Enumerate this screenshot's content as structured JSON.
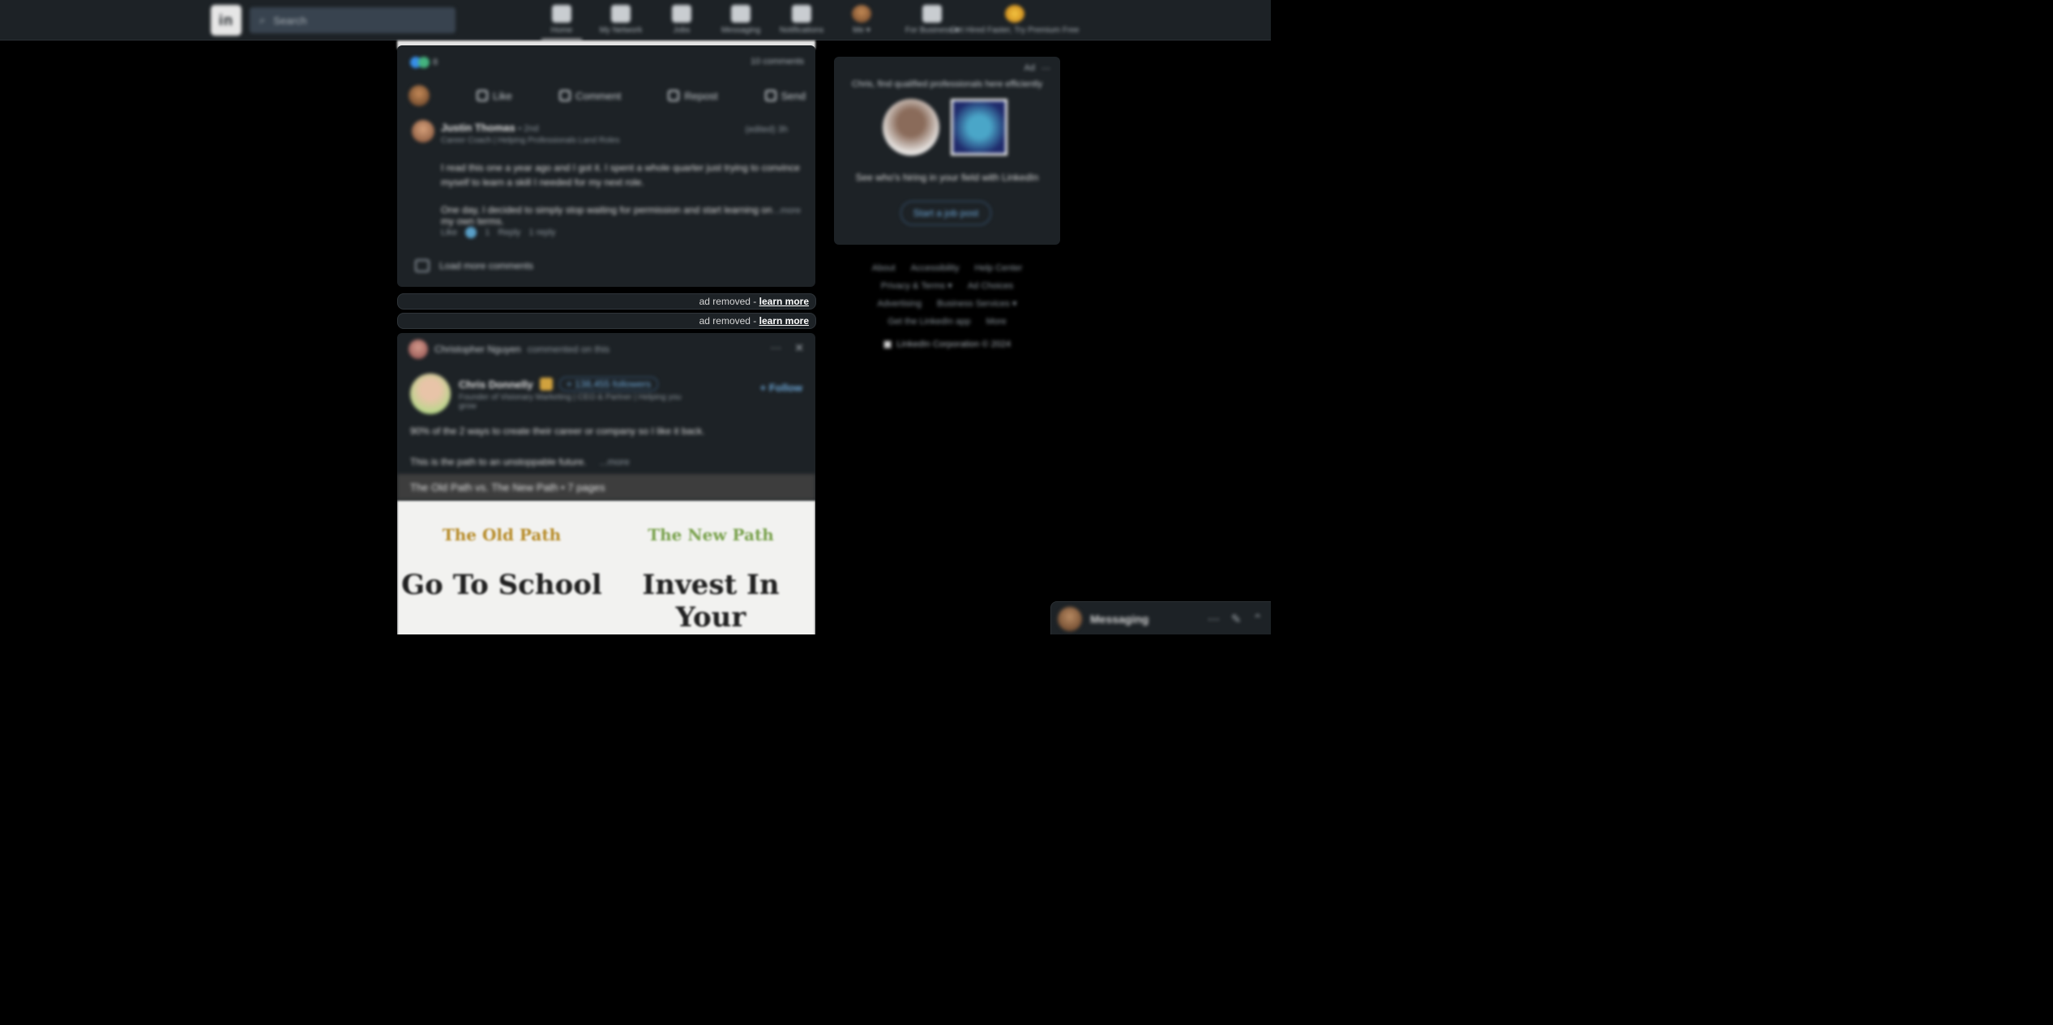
{
  "nav": {
    "logo_text": "in",
    "search_placeholder": "Search",
    "items": [
      {
        "label": "Home",
        "icon": "home-icon"
      },
      {
        "label": "My Network",
        "icon": "network-icon"
      },
      {
        "label": "Jobs",
        "icon": "jobs-icon"
      },
      {
        "label": "Messaging",
        "icon": "messaging-icon"
      },
      {
        "label": "Notifications",
        "icon": "bell-icon"
      },
      {
        "label": "Me ▾",
        "icon": "avatar"
      },
      {
        "label": "For Business ▾",
        "icon": "grid-icon"
      },
      {
        "label": "Get Hired Faster, Try Premium Free",
        "icon": "premium-icon"
      }
    ]
  },
  "post1": {
    "reaction_count": "8",
    "comments_count": "10 comments",
    "actions": [
      "Like",
      "Comment",
      "Repost",
      "Send"
    ],
    "comment": {
      "author": "Justin Thomas",
      "degree": "• 2nd",
      "headline": "Career Coach | Helping Professionals Land Roles",
      "time": "(edited) 3h",
      "body1": "I read this one a year ago and I got it. I spent a whole quarter just trying to convince myself to learn a skill I needed for my next role.",
      "body2": "One day, I decided to simply stop waiting for permission and start learning on my own terms.",
      "more": "...more",
      "meta_like": "Like",
      "meta_count": "1",
      "meta_reply": "Reply",
      "meta_replies": "1 reply"
    },
    "load_more": "Load more comments"
  },
  "ads": [
    {
      "text": "ad removed - ",
      "link": "learn more"
    },
    {
      "text": "ad removed - ",
      "link": "learn more"
    }
  ],
  "post2": {
    "reposter": "Christopher Nguyen",
    "reposter_action": "commented on this",
    "author": "Chris Donnelly",
    "followers": "+ 138,455 followers",
    "author_sub": "Founder of Visionary Marketing | CEO & Partner | Helping you grow",
    "follow": "+ Follow",
    "text1": "90% of the 2 ways to create their career or company so I like it back.",
    "text2": "This is the path to an unstoppable future.",
    "see_more": "...more",
    "doc_title": "The Old Path vs. The New Path • 7 pages",
    "doc_left_tag": "The Old Path",
    "doc_left_big": "Go To School",
    "doc_right_tag": "The New Path",
    "doc_right_big": "Invest In Your Skillstack"
  },
  "rail": {
    "ad_label": "Ad",
    "line1": "Chris, find qualified professionals here efficiently",
    "line2": "See who's hiring in your field with LinkedIn",
    "button": "Start a job post",
    "footer_links": [
      "About",
      "Accessibility",
      "Help Center",
      "Privacy & Terms ▾",
      "Ad Choices",
      "Advertising",
      "Business Services ▾",
      "Get the LinkedIn app",
      "More"
    ],
    "corp": "LinkedIn Corporation © 2024"
  },
  "messaging": {
    "label": "Messaging"
  }
}
